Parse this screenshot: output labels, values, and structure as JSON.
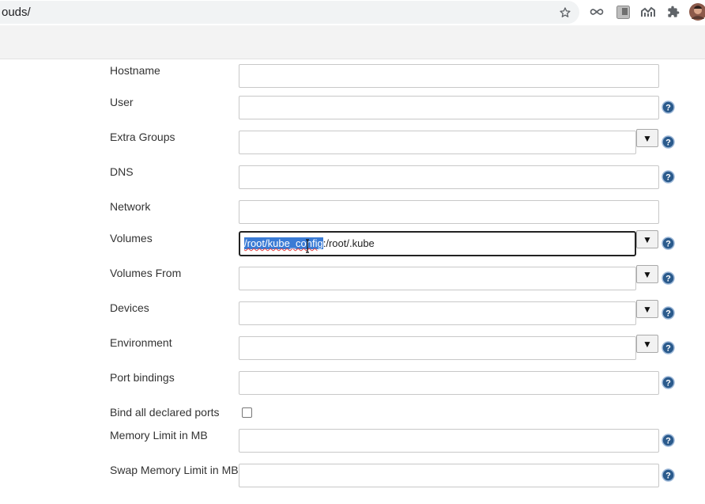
{
  "browser": {
    "url": "ouds/",
    "icons": [
      "star-icon",
      "infinity-icon",
      "extension-icon",
      "chart-icon",
      "puzzle-icon",
      "avatar-icon"
    ]
  },
  "form": {
    "hostname_label": "Hostname",
    "user_label": "User",
    "extra_groups_label": "Extra Groups",
    "dns_label": "DNS",
    "network_label": "Network",
    "volumes_label": "Volumes",
    "volumes_value_selected": "/root/kube_config",
    "volumes_value_rest": ":/root/.kube",
    "volumes_from_label": "Volumes From",
    "devices_label": "Devices",
    "environment_label": "Environment",
    "port_bindings_label": "Port bindings",
    "bind_all_label": "Bind all declared ports",
    "memory_limit_label": "Memory Limit in MB",
    "swap_limit_label": "Swap Memory Limit in MB",
    "dropdown_glyph": "▼",
    "help_color": "#2a5a8c"
  }
}
